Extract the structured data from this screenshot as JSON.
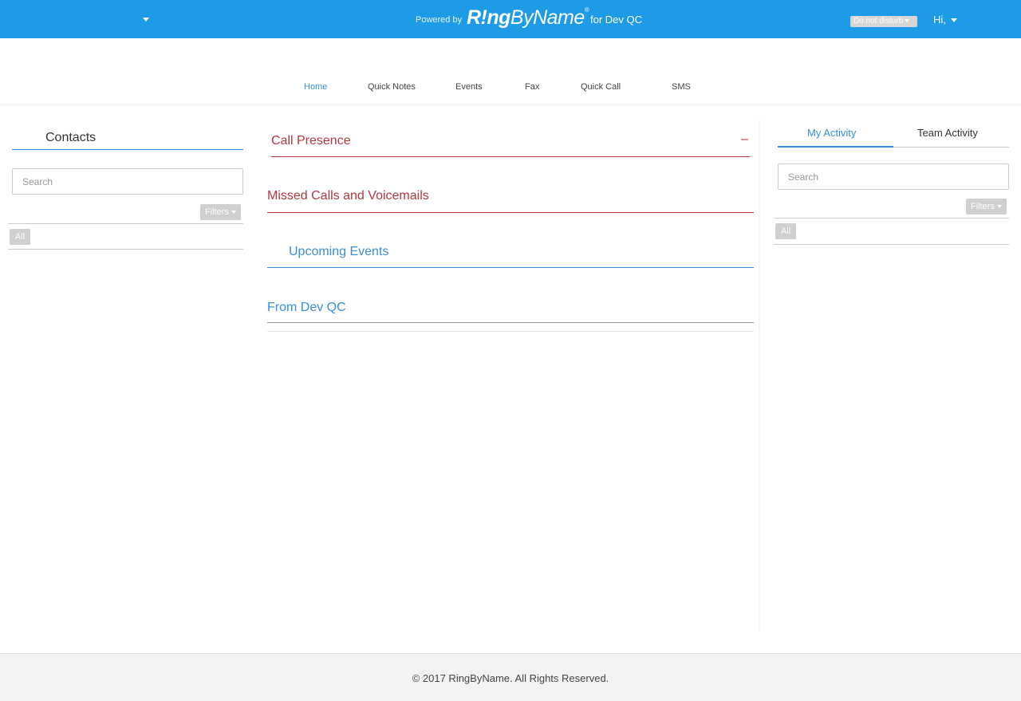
{
  "topbar": {
    "powered_by": "Powered by",
    "logo_part1": "R!ng",
    "logo_part2": "ByName",
    "logo_reg": "®",
    "for_org": "for Dev QC",
    "status": "Do not disturb",
    "greeting": "Hi,"
  },
  "nav": {
    "items": [
      {
        "label": "Home",
        "active": true
      },
      {
        "label": "Quick Notes"
      },
      {
        "label": "Events"
      },
      {
        "label": "Fax"
      },
      {
        "label": "Quick Call"
      },
      {
        "label": "SMS"
      }
    ]
  },
  "contacts": {
    "title": "Contacts",
    "search_placeholder": "Search",
    "filters_label": "Filters",
    "all_label": "All"
  },
  "center": {
    "call_presence": "Call Presence",
    "collapse_symbol": "–",
    "missed_calls": "Missed Calls and Voicemails",
    "upcoming_events": "Upcoming Events",
    "from_org": "From Dev QC"
  },
  "activity": {
    "tabs": [
      {
        "label": "My Activity",
        "active": true
      },
      {
        "label": "Team Activity"
      }
    ],
    "search_placeholder": "Search",
    "filters_label": "Filters",
    "all_label": "All"
  },
  "footer": {
    "copyright": "© 2017 RingByName. All Rights Reserved."
  },
  "colors": {
    "topbar_bg": "#1e9be6",
    "accent_blue": "#3a8fd4",
    "accent_red": "#b4373f"
  }
}
